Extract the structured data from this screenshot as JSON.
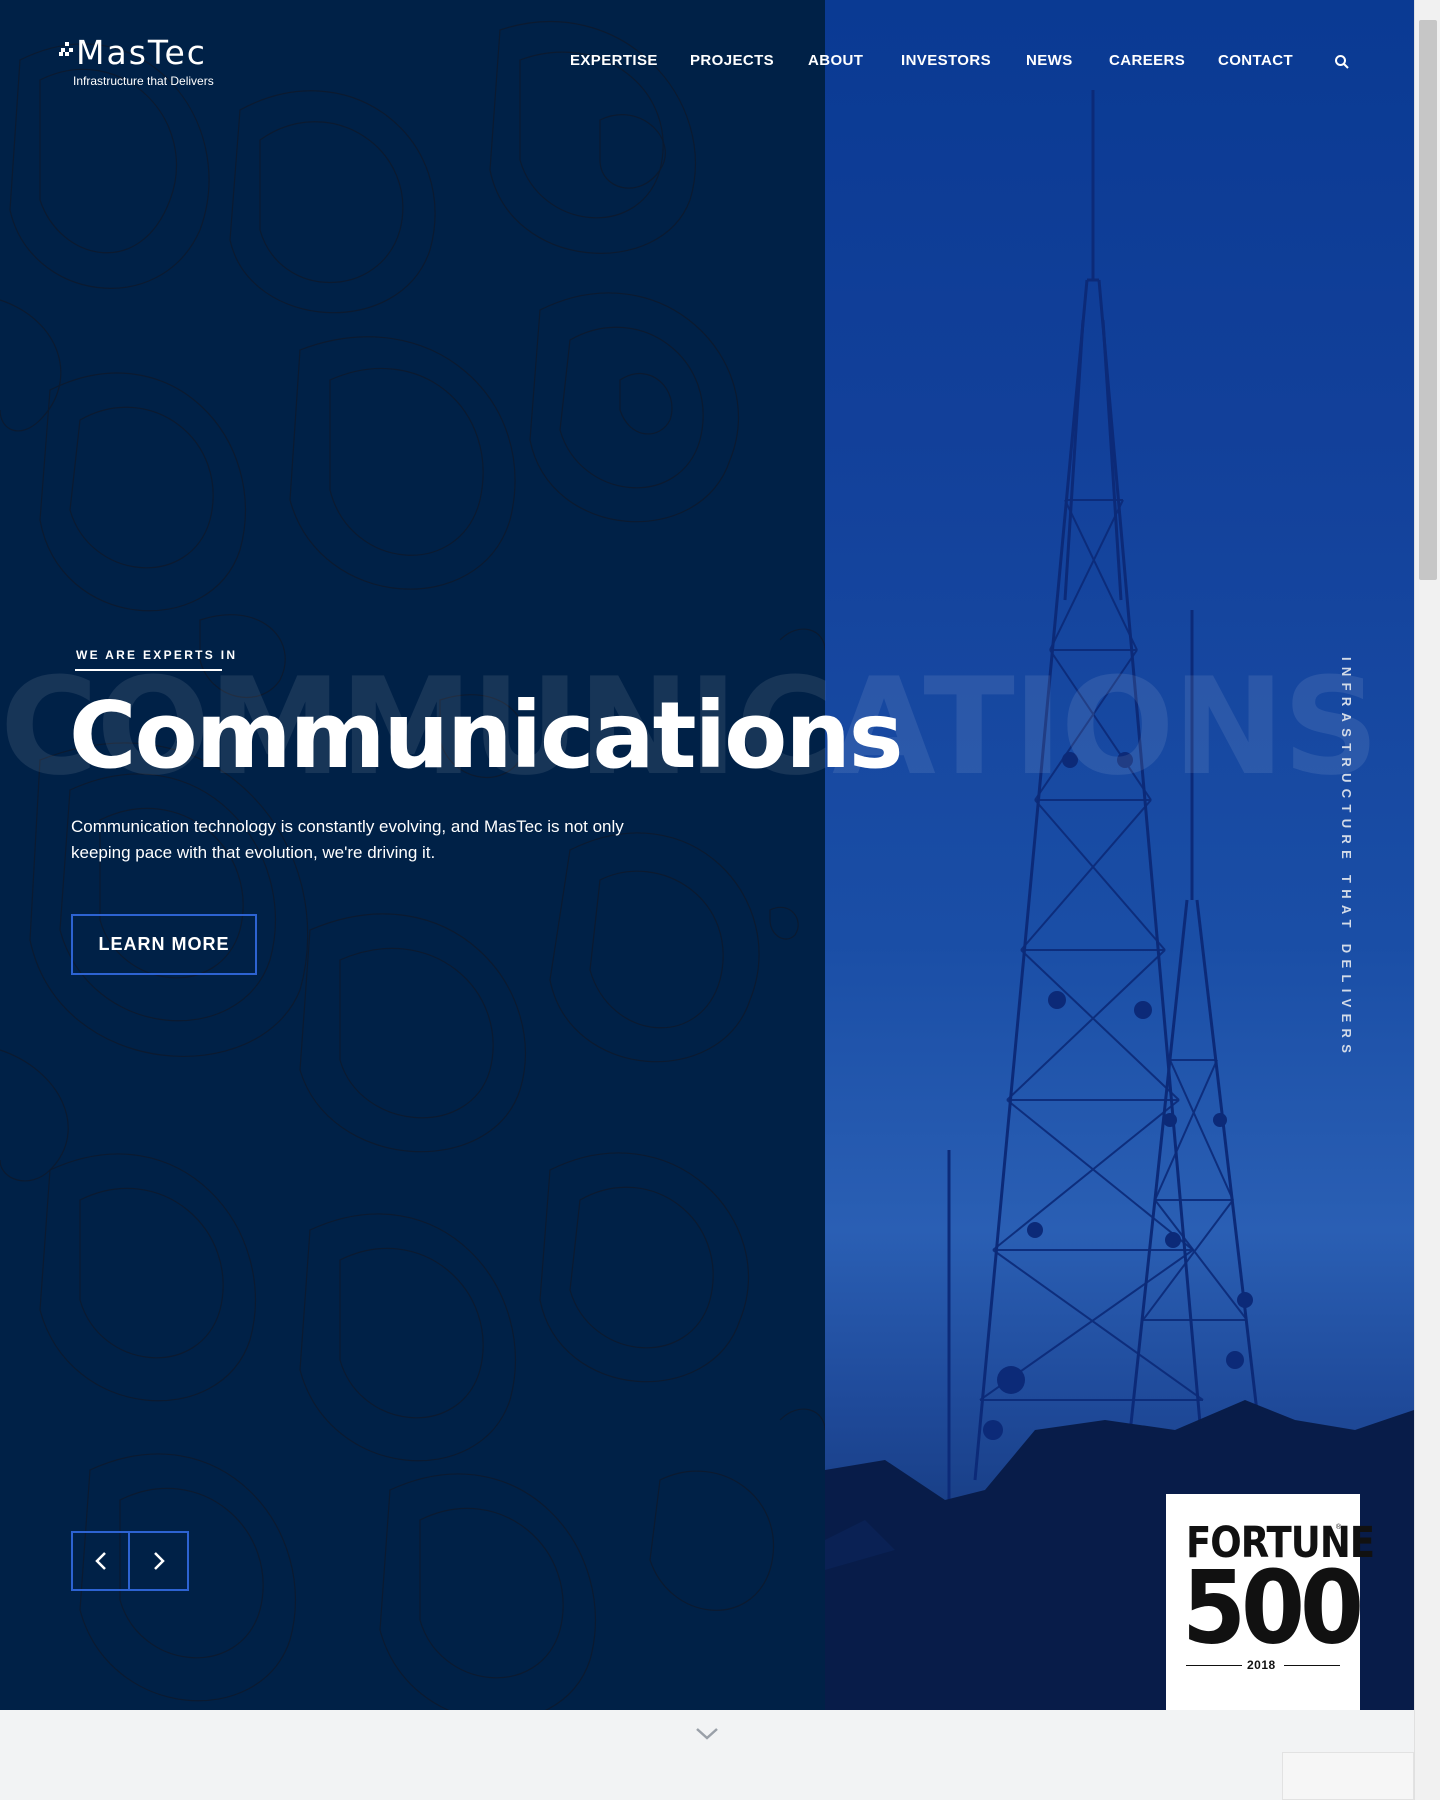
{
  "brand": {
    "name": "MasTec",
    "tagline": "Infrastructure that Delivers"
  },
  "nav": {
    "items": [
      {
        "label": "EXPERTISE"
      },
      {
        "label": "PROJECTS"
      },
      {
        "label": "ABOUT"
      },
      {
        "label": "INVESTORS"
      },
      {
        "label": "NEWS"
      },
      {
        "label": "CAREERS"
      },
      {
        "label": "CONTACT"
      }
    ],
    "search_icon": "search-icon"
  },
  "hero": {
    "eyebrow": "WE ARE EXPERTS IN",
    "headline": "Communications",
    "ghost_word": "COMMUNICATIONS",
    "description": "Communication technology is constantly evolving, and MasTec is not only keeping pace with that evolution, we're driving it.",
    "cta_label": "LEARN MORE",
    "vertical_tag": "INFRASTRUCTURE THAT DELIVERS",
    "prev_icon": "chevron-left-icon",
    "next_icon": "chevron-right-icon"
  },
  "fortune": {
    "word": "FORTUNE",
    "registered": "®",
    "number": "500",
    "year": "2018"
  },
  "colors": {
    "navy": "#002147",
    "accent_blue": "#2d63d2",
    "photo_blue": "#1a4ea6"
  }
}
